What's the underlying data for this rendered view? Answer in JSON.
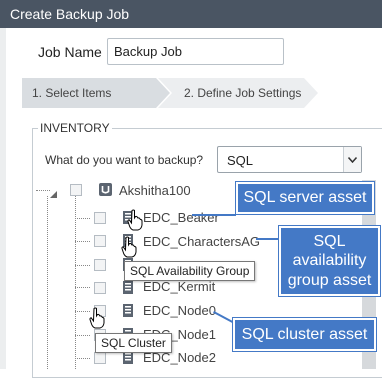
{
  "window": {
    "title": "Create Backup Job"
  },
  "job": {
    "name_label": "Job Name",
    "name_value": "Backup Job"
  },
  "wizard": {
    "steps": [
      {
        "label": "1. Select Items"
      },
      {
        "label": "2. Define Job Settings"
      }
    ]
  },
  "inventory": {
    "title": "INVENTORY",
    "question": "What do you want to backup?",
    "selected_type": "SQL",
    "root": {
      "label": "Akshitha100",
      "icon": "server-icon"
    },
    "nodes": [
      {
        "label": "EDC_Beaker",
        "icon": "database-icon"
      },
      {
        "label": "EDC_CharactersAG",
        "icon": "database-icon"
      },
      {
        "label": "",
        "icon": "database-icon"
      },
      {
        "label": "EDC_Kermit",
        "icon": "database-icon"
      },
      {
        "label": "EDC_Node0",
        "icon": "database-icon"
      },
      {
        "label": "EDC_Node1",
        "icon": "database-icon"
      },
      {
        "label": "EDC_Node2",
        "icon": "database-icon"
      }
    ]
  },
  "tooltips": {
    "availability_group": "SQL Availability Group",
    "cluster": "SQL Cluster"
  },
  "callouts": {
    "server": "SQL server asset",
    "availability": "SQL availability group asset",
    "cluster": "SQL cluster asset"
  },
  "colors": {
    "titlebar": "#4a5563",
    "callout": "#4479c6"
  }
}
